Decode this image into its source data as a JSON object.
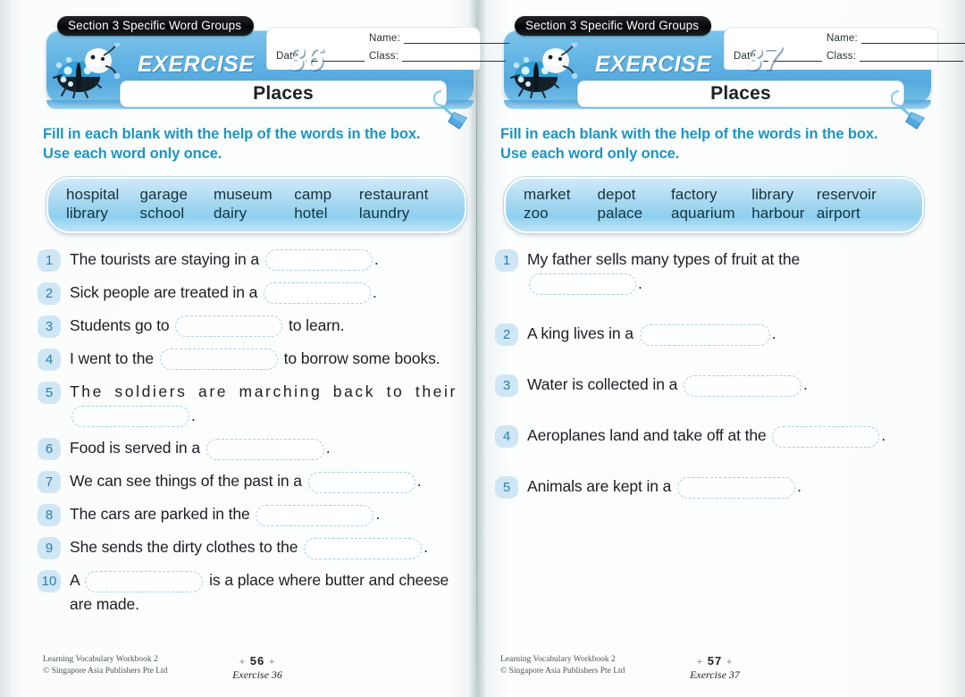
{
  "book": {
    "credit_line1": "Learning Vocabulary Workbook 2",
    "credit_line2": "© Singapore Asia Publishers Pte Ltd",
    "tick": "+"
  },
  "colors": {
    "banner_blue": "#63b4e4",
    "instruction_teal": "#1d95c2",
    "wordbank_blue": "#a7d8f1",
    "number_badge": "#cfe6f5",
    "number_text": "#2a7fb0",
    "blank_outline": "#a9cfe3",
    "section_tab_bg": "#050608"
  },
  "left_page": {
    "section_tab": "Section 3  Specific Word Groups",
    "exercise_word": "EXERCISE",
    "exercise_number": "36",
    "title": "Places",
    "name_label": "Name:",
    "date_label": "Date:",
    "class_label": "Class:",
    "instructions_line1": "Fill in each blank with the help of the words in the box.",
    "instructions_line2": "Use each word only once.",
    "wordbank": {
      "row1": [
        "hospital",
        "garage",
        "museum",
        "camp",
        "restaurant"
      ],
      "row2": [
        "library",
        "school",
        "dairy",
        "hotel",
        "laundry"
      ]
    },
    "questions": [
      {
        "num": "1",
        "pre": "The tourists are staying in a ",
        "post": "."
      },
      {
        "num": "2",
        "pre": "Sick people are treated in a ",
        "post": "."
      },
      {
        "num": "3",
        "pre": "Students go to ",
        "post": " to learn."
      },
      {
        "num": "4",
        "pre": "I went to the ",
        "post": " to borrow some books."
      },
      {
        "num": "5",
        "line1": "The soldiers are marching back to their",
        "post": "."
      },
      {
        "num": "6",
        "pre": "Food is served in a ",
        "post": "."
      },
      {
        "num": "7",
        "pre": "We can see things of the past in a ",
        "post": "."
      },
      {
        "num": "8",
        "pre": "The cars are parked in the ",
        "post": "."
      },
      {
        "num": "9",
        "pre": "She sends the dirty clothes to the ",
        "post": "."
      },
      {
        "num": "10",
        "pre": "A ",
        "post": " is a place where butter and cheese",
        "line2": "are made."
      }
    ],
    "footer": {
      "page": "56",
      "exercise": "Exercise 36"
    }
  },
  "right_page": {
    "section_tab": "Section 3  Specific Word Groups",
    "exercise_word": "EXERCISE",
    "exercise_number": "37",
    "title": "Places",
    "name_label": "Name:",
    "date_label": "Date:",
    "class_label": "Class:",
    "instructions_line1": "Fill in each blank with the help of the words in the box.",
    "instructions_line2": "Use each word only once.",
    "wordbank": {
      "row1": [
        "market",
        "depot",
        "factory",
        "library",
        "reservoir"
      ],
      "row2": [
        "zoo",
        "palace",
        "aquarium",
        "harbour",
        "airport"
      ]
    },
    "questions": [
      {
        "num": "1",
        "line1": "My father sells many types of fruit at the",
        "post": "."
      },
      {
        "num": "2",
        "pre": "A king lives in a ",
        "post": "."
      },
      {
        "num": "3",
        "pre": "Water is collected in a ",
        "post": "."
      },
      {
        "num": "4",
        "pre": "Aeroplanes land and take off at the ",
        "post": "."
      },
      {
        "num": "5",
        "pre": "Animals are kept in a ",
        "post": "."
      }
    ],
    "footer": {
      "page": "57",
      "exercise": "Exercise 37"
    }
  }
}
